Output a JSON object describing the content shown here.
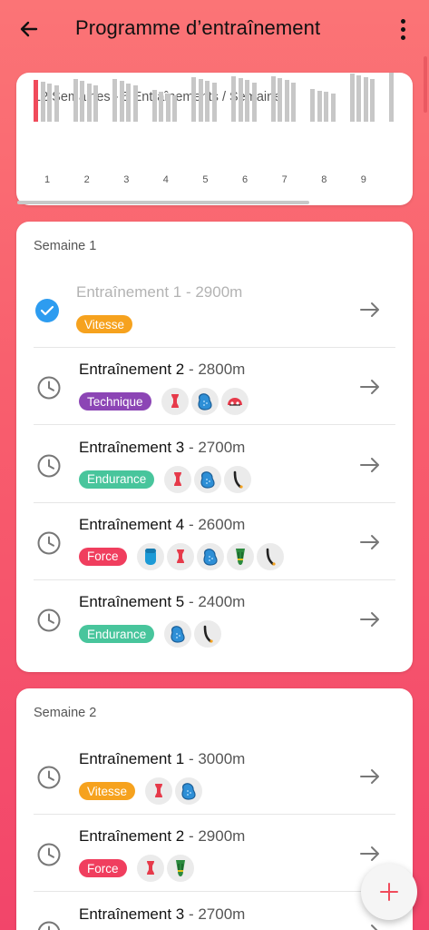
{
  "header": {
    "title": "Programme d’entraînement"
  },
  "overview": {
    "title": "12 Semaines - 5 Entraînements / Semaine",
    "weeks": [
      {
        "label": "1",
        "bars": [
          46,
          44,
          42,
          40
        ],
        "completed": 1
      },
      {
        "label": "2",
        "bars": [
          47,
          45,
          42,
          40
        ],
        "completed": 0
      },
      {
        "label": "3",
        "bars": [
          47,
          45,
          42,
          40
        ],
        "completed": 0
      },
      {
        "label": "4",
        "bars": [
          35,
          33,
          31,
          29
        ],
        "completed": 0
      },
      {
        "label": "5",
        "bars": [
          49,
          47,
          45,
          43
        ],
        "completed": 0
      },
      {
        "label": "6",
        "bars": [
          50,
          48,
          46,
          43
        ],
        "completed": 0
      },
      {
        "label": "7",
        "bars": [
          50,
          48,
          46,
          43
        ],
        "completed": 0
      },
      {
        "label": "8",
        "bars": [
          36,
          34,
          33,
          31
        ],
        "completed": 0
      },
      {
        "label": "9",
        "bars": [
          53,
          51,
          49,
          47
        ],
        "completed": 0
      },
      {
        "label": "",
        "bars": [
          54
        ],
        "completed": 0
      }
    ]
  },
  "weeks": [
    {
      "title": "Semaine 1",
      "sessions": [
        {
          "name": "Entraînement 1",
          "distance": " - 2900m",
          "status": "completed",
          "tag": "Vitesse",
          "tag_type": "vitesse",
          "equipment": []
        },
        {
          "name": "Entraînement 2",
          "distance": " - 2800m",
          "status": "pending",
          "tag": "Technique",
          "tag_type": "technique",
          "equipment": [
            "pull-buoy-icon",
            "paddles-icon",
            "snorkel-icon"
          ]
        },
        {
          "name": "Entraînement 3",
          "distance": " - 2700m",
          "status": "pending",
          "tag": "Endurance",
          "tag_type": "endurance",
          "equipment": [
            "pull-buoy-icon",
            "paddles-icon",
            "snorkel-tube-icon"
          ]
        },
        {
          "name": "Entraînement 4",
          "distance": " - 2600m",
          "status": "pending",
          "tag": "Force",
          "tag_type": "force",
          "equipment": [
            "kickboard-icon",
            "pull-buoy-icon",
            "paddles-icon",
            "fins-icon",
            "snorkel-tube-icon"
          ]
        },
        {
          "name": "Entraînement 5",
          "distance": " - 2400m",
          "status": "pending",
          "tag": "Endurance",
          "tag_type": "endurance",
          "equipment": [
            "paddles-icon",
            "snorkel-tube-icon"
          ]
        }
      ]
    },
    {
      "title": "Semaine 2",
      "sessions": [
        {
          "name": "Entraînement 1",
          "distance": " - 3000m",
          "status": "pending",
          "tag": "Vitesse",
          "tag_type": "vitesse",
          "equipment": [
            "pull-buoy-icon",
            "paddles-icon"
          ]
        },
        {
          "name": "Entraînement 2",
          "distance": " - 2900m",
          "status": "pending",
          "tag": "Force",
          "tag_type": "force",
          "equipment": [
            "pull-buoy-icon",
            "fins-icon"
          ]
        },
        {
          "name": "Entraînement 3",
          "distance": " - 2700m",
          "status": "pending",
          "tag": "",
          "tag_type": "",
          "equipment": []
        }
      ]
    }
  ],
  "colors": {
    "accent": "#f04b5b",
    "vitesse": "#f6a21e",
    "technique": "#8c45b5",
    "endurance": "#48c59c",
    "force": "#f03e5e",
    "completed": "#2d9cf0"
  }
}
